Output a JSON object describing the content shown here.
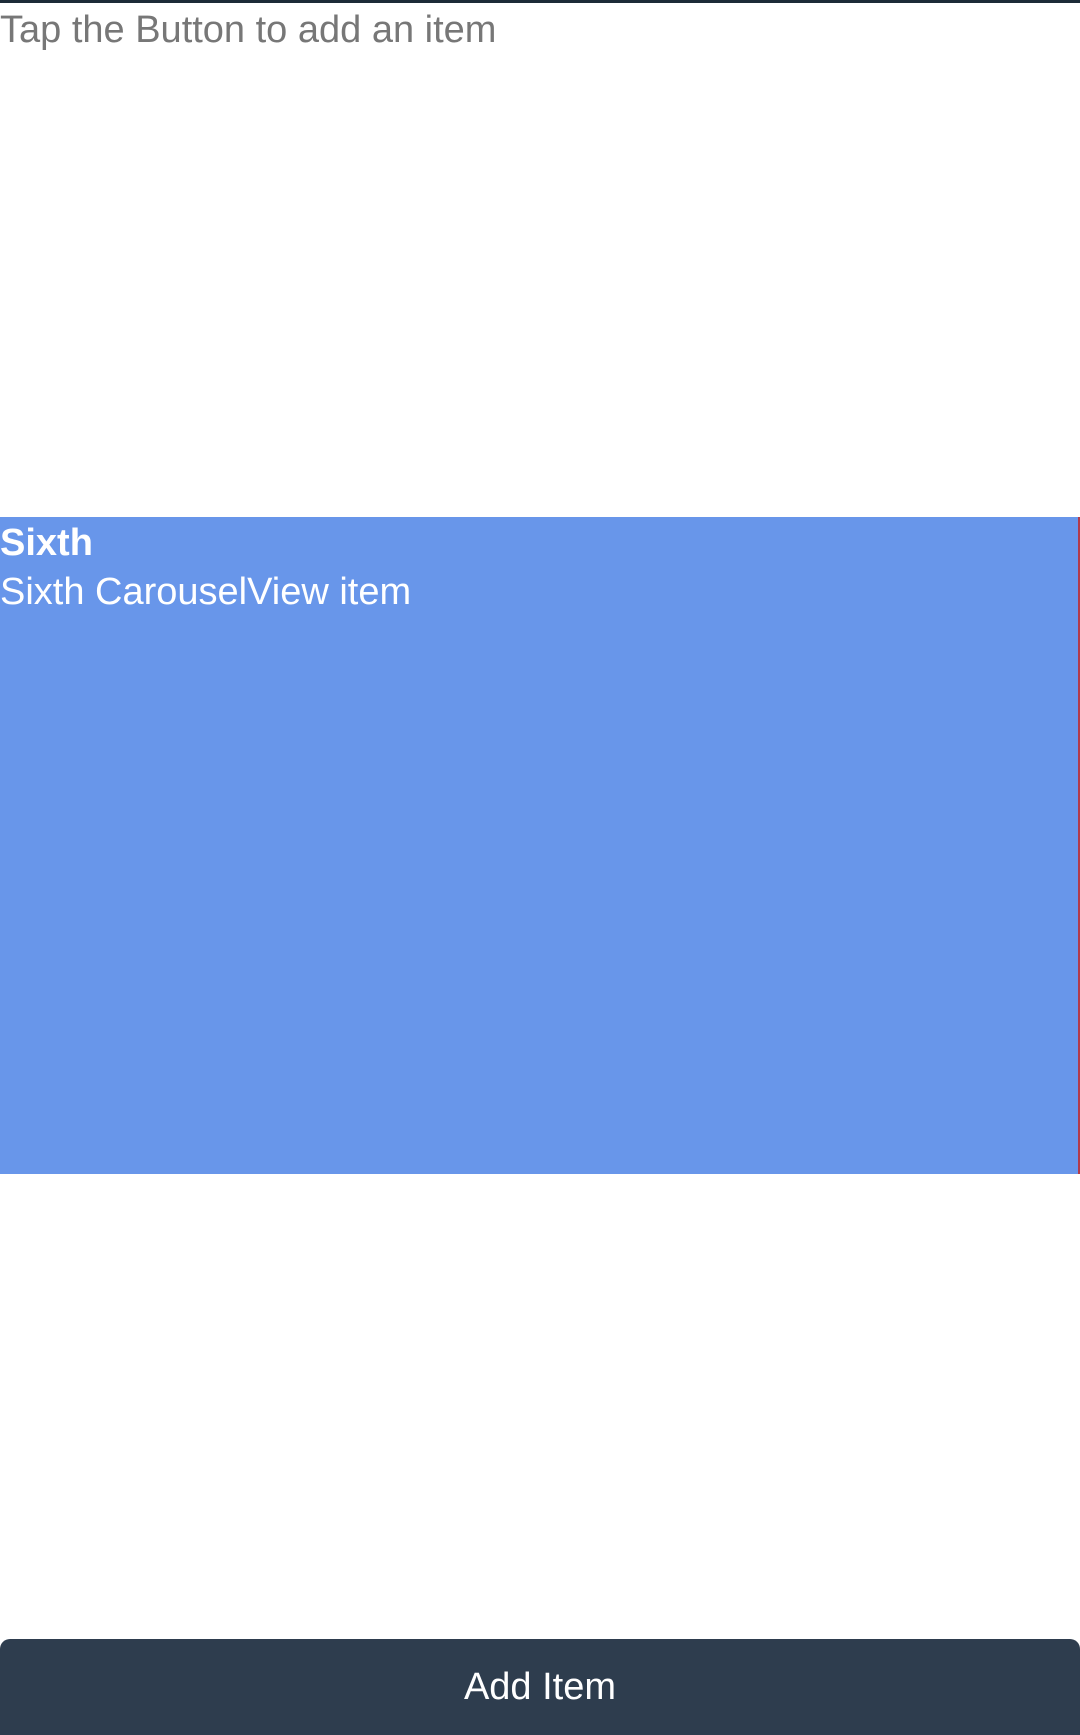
{
  "colors": {
    "top_rule": "#1c2b38",
    "carousel_item_background": "#6896ea",
    "button_background": "#2e3d4e",
    "instruction_text": "#777777"
  },
  "instructions": "Tap the Button to add an item",
  "carousel": {
    "current_item": {
      "title": "Sixth",
      "subtitle": "Sixth CarouselView item"
    }
  },
  "add_button_label": "Add Item"
}
